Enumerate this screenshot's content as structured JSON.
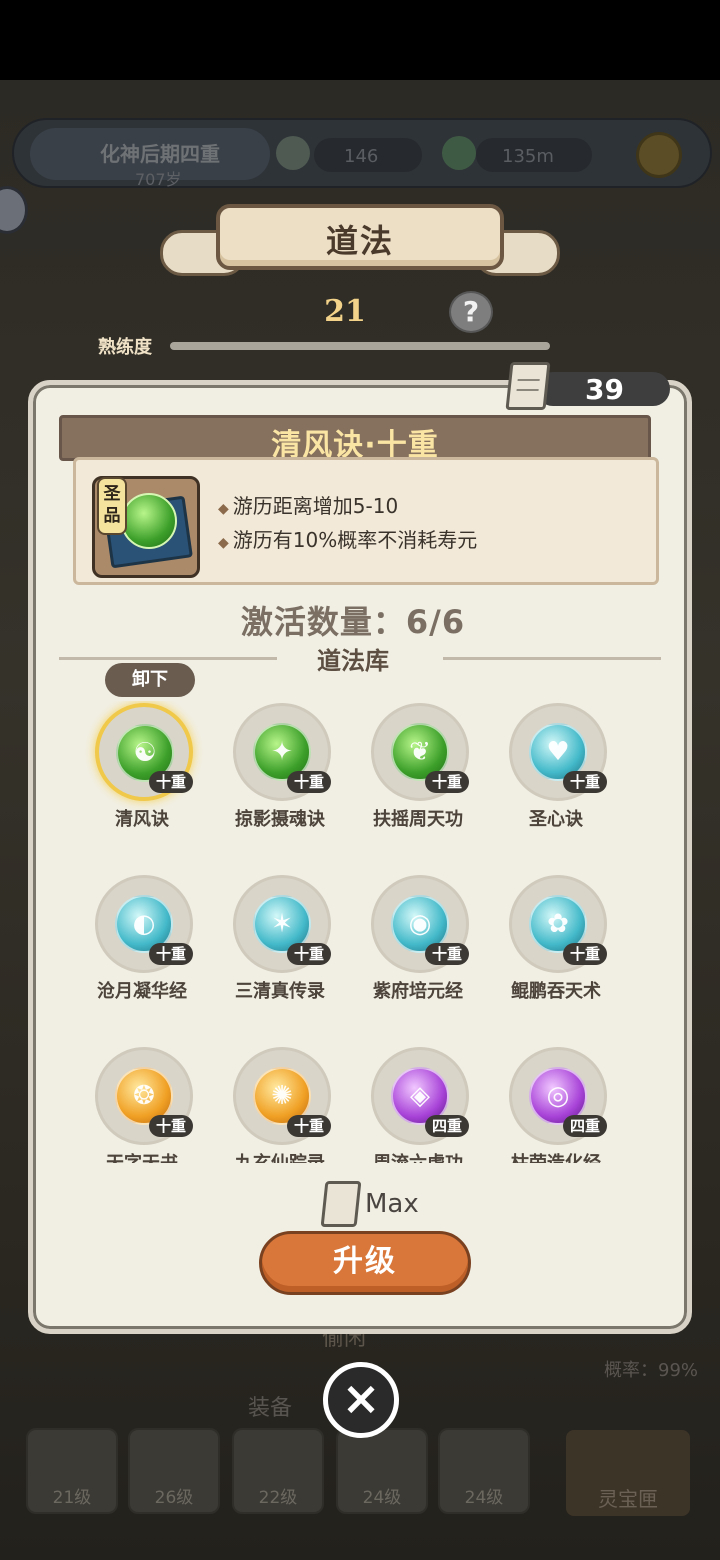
{
  "topbar": {
    "rank": "化神后期四重",
    "age": "707岁",
    "resource_a": "146",
    "resource_b": "135m"
  },
  "banner": {
    "title": "道法"
  },
  "proficiency": {
    "value": "21",
    "label": "熟练度",
    "help": "?"
  },
  "scroll_count": "39",
  "selected_skill": {
    "name": "清风诀·十重",
    "grade": "圣品",
    "effects": [
      "游历距离增加5-10",
      "游历有10%概率不消耗寿元"
    ]
  },
  "activation": {
    "text": "激活数量：6/6"
  },
  "library": {
    "title": "道法库",
    "unload_label": "卸下",
    "skills": [
      {
        "name": "清风诀",
        "level": "十重",
        "color": "green",
        "glyph": "☯"
      },
      {
        "name": "掠影摄魂诀",
        "level": "十重",
        "color": "green",
        "glyph": "✦"
      },
      {
        "name": "扶摇周天功",
        "level": "十重",
        "color": "green",
        "glyph": "❦"
      },
      {
        "name": "圣心诀",
        "level": "十重",
        "color": "cyan",
        "glyph": "♥"
      },
      {
        "name": "沧月凝华经",
        "level": "十重",
        "color": "cyan",
        "glyph": "◐"
      },
      {
        "name": "三清真传录",
        "level": "十重",
        "color": "cyan",
        "glyph": "✶"
      },
      {
        "name": "紫府培元经",
        "level": "十重",
        "color": "cyan",
        "glyph": "◉"
      },
      {
        "name": "鲲鹏吞天术",
        "level": "十重",
        "color": "cyan",
        "glyph": "✿"
      },
      {
        "name": "天字天书",
        "level": "十重",
        "color": "gold",
        "glyph": "❂"
      },
      {
        "name": "九玄仙踪录",
        "level": "十重",
        "color": "gold",
        "glyph": "✺"
      },
      {
        "name": "周流六虚功",
        "level": "四重",
        "color": "purple",
        "glyph": "◈"
      },
      {
        "name": "枯荣造化经",
        "level": "四重",
        "color": "purple",
        "glyph": "◎"
      }
    ]
  },
  "max_label": "Max",
  "upgrade_label": "升级",
  "close_icon": "×",
  "bottom": {
    "equip_title": "装备",
    "prob_text": "概率：99%",
    "slots": [
      "21级",
      "26级",
      "22级",
      "24级",
      "24级"
    ],
    "lingbao": "灵宝匣",
    "bg_word": "偷闲"
  }
}
